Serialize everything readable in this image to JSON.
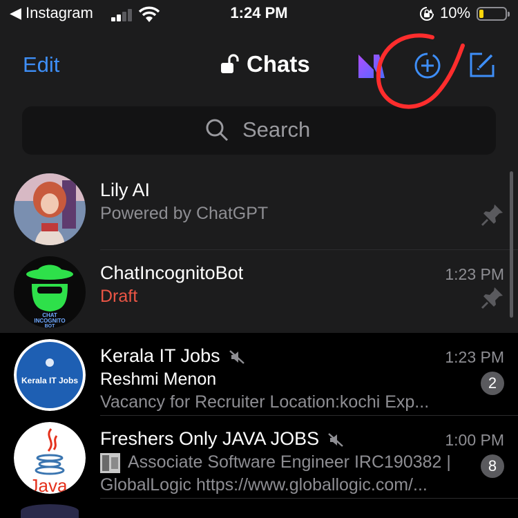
{
  "status_bar": {
    "back_label": "◀ Instagram",
    "time": "1:24 PM",
    "battery_percent": "10%",
    "battery_level": 0.1,
    "icons": [
      "signal-icon",
      "wifi-icon",
      "orientation-lock-icon",
      "battery-icon"
    ]
  },
  "nav": {
    "edit_label": "Edit",
    "title": "Chats",
    "icons": [
      "lock-open-icon",
      "app-logo-icon",
      "new-story-icon",
      "compose-icon"
    ]
  },
  "search": {
    "placeholder": "Search"
  },
  "colors": {
    "accent": "#3e8ef7",
    "draft": "#eb5545",
    "annotation": "#ff2d2d"
  },
  "chats": [
    {
      "title": "Lily AI",
      "subtitle": "Powered by ChatGPT",
      "time": "",
      "pinned": true
    },
    {
      "title": "ChatIncognitoBot",
      "subtitle": "Draft",
      "time": "1:23 PM",
      "pinned": true
    },
    {
      "title": "Kerala IT Jobs",
      "sender": "Reshmi Menon",
      "preview": "Vacancy for Recruiter Location:kochi Exp...",
      "time": "1:23 PM",
      "unread": "2",
      "muted": true,
      "avatar_text": "Kerala IT Jobs"
    },
    {
      "title": "Freshers Only JAVA JOBS",
      "preview_line1": "Associate Software Engineer IRC190382 |",
      "preview_line2": "GlobalLogic https://www.globallogic.com/...",
      "time": "1:00 PM",
      "unread": "8",
      "muted": true,
      "avatar_text": "Java"
    }
  ]
}
